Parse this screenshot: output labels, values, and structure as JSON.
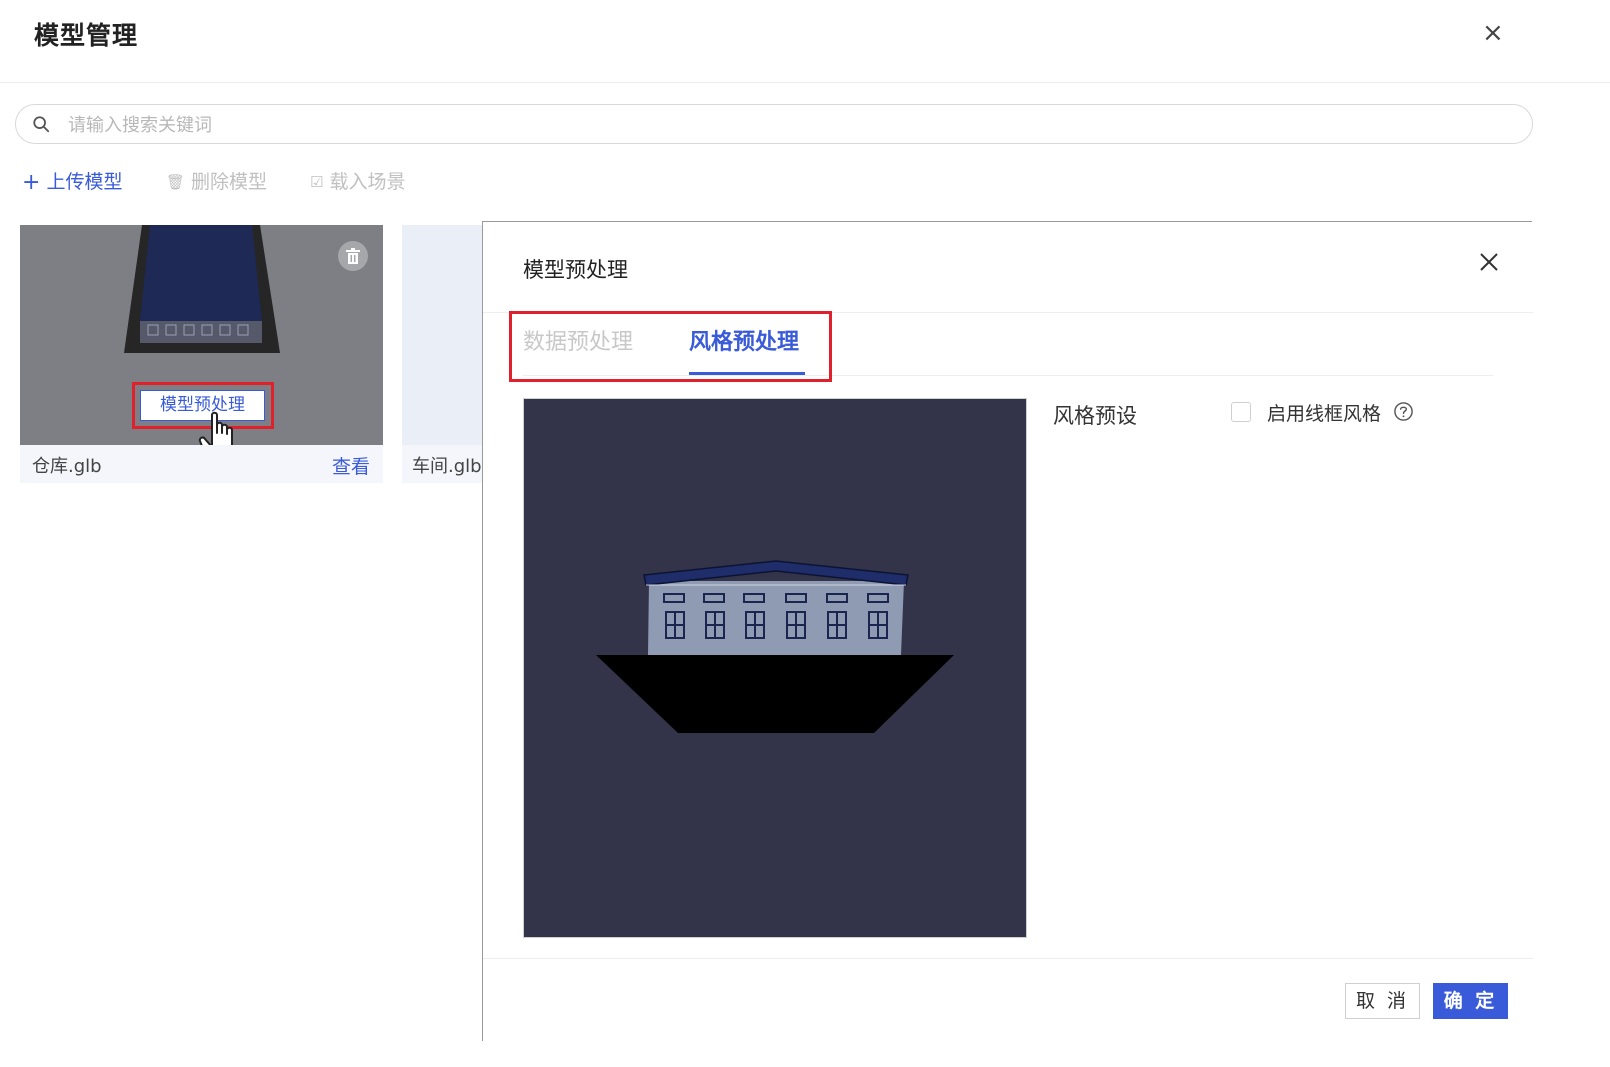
{
  "main": {
    "title": "模型管理",
    "close_label": "×",
    "search": {
      "placeholder": "请输入搜索关键词",
      "value": ""
    },
    "toolbar": {
      "upload_icon": "+",
      "upload_label": "上传模型",
      "delete_icon": "🗑",
      "delete_label": "删除模型",
      "load_icon": "☑",
      "load_label": "载入场景"
    },
    "cards": [
      {
        "filename": "仓库.glb",
        "view_label": "查看",
        "preprocess_label": "模型预处理"
      },
      {
        "filename": "车间.glb"
      }
    ]
  },
  "modal": {
    "title": "模型预处理",
    "tabs": [
      {
        "label": "数据预处理",
        "active": false
      },
      {
        "label": "风格预处理",
        "active": true
      }
    ],
    "style_preset_label": "风格预设",
    "wireframe_label": "启用线框风格",
    "wireframe_checked": false,
    "cancel_label": "取 消",
    "ok_label": "确 定"
  },
  "colors": {
    "accent": "#3a5bd9",
    "highlight_border": "#e0202a",
    "preview_bg": "#33334a",
    "thumb_bg": "#7d7f85"
  }
}
